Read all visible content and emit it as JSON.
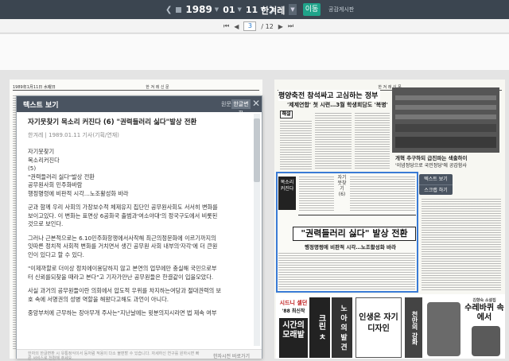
{
  "topbar": {
    "year": "1989",
    "month": "01",
    "day": "11",
    "paper_name": "한겨레",
    "move_button": "이동",
    "official_link": "공감게시판"
  },
  "pager": {
    "current": "3",
    "total": "/ 12"
  },
  "newspaper_left": {
    "header": "1989年1月11日 水曜日",
    "masthead": "한 겨 레 신 문"
  },
  "text_panel": {
    "title": "텍스트 보기",
    "original_button": "원문",
    "convert_button": "한글변환",
    "article_title": "자기뭇찾기 목소리 커진다 (6) \"권력들러리 싫다\"발상 전환",
    "meta": "한겨레 | 1989.01.11 기사(기획/연재)",
    "lines": [
      "자기뭇찾기",
      "목소리커진다",
      "  (5)",
      "\"권력들러리 싫다\"발상 전환",
      "공무원사회 민주화바람",
      "행정명령에 비판적 시각…노조활성화 바라",
      "",
      " 군과 함께 우리 사회의 가장보수적 체제유지 집단인 공무원사회도 서서히 변화를",
      "보이고있다. 이 변화는 표면상 6공화국 출범과'여소야대'의 정국구도에서 비롯된",
      "것으로 보인다.",
      "",
      " 그러나 근본적으로는 6.10민주화항쟁에서사작해 최근의정문화에 이르기까지의",
      "잇따른 정치적 사회적 변화를 거치면서 생긴 공무원 사회 내부의'자각'에 더 큰원",
      "인이 있다고 할 수 있다.",
      "",
      " \"이제까할로 더이상 정치에이용당하지 않고 본연의 업무에만 충실해 국민으로부",
      "터 신뢰를되찾을 때라고 본다\"고 기자가만난 공무원들은 한결같이 입을모았다.",
      "",
      " 사실 과거의 공무원들이란 의회에서 압도적 우위를 차지하는여당과 절대권력의 보",
      "호 속에 서명권의 성병 역할을 해왔다고해도 과언이 아니다.",
      "",
      " 중앙부처에 근무하는 장아무개 주사는\"지난날에는 윗분의지시라면 법 제속 여부"
    ],
    "footnote": "한자의 한글변환 시 유통정식이서 등처럼 적용이 다소 불편할 수 있습니다. 자세하신 연구를 원하시면 빠른 서비스로 전환해 주세요.",
    "footer_link": "한자시전 바로가기"
  },
  "newspaper_right": {
    "masthead": "한 겨 레 신 문",
    "headline": "평양축전 참석싸고 고심하는 정부",
    "subhead": "'제제연합' 첫 시련…3월 학생회담도 '복병'",
    "box_label": "해설",
    "photo_caption_1": "개혁 추구하되 급진파는 색출하이",
    "photo_caption_2": "'이념정당으로 국민정당'에 공감함사",
    "logo_text": "목소리 커진다",
    "vertical_title": "자기뭇찾기 (6)",
    "banner": "\"권력들러리 싫다\" 발상 전환",
    "banner_sub": "행정명령에 비판적 시각…노조활성화 바라",
    "popup_text": "텍스트 보기",
    "popup_scrap": "스크랩 하기",
    "ads": {
      "ad1_title": "시드니 셀던",
      "ad1_sub": "'88 최신작",
      "ad1_big": "시간의 모래밭",
      "ad2": "크린 ㅊ",
      "ad3": "노 아 의 발 견",
      "ad4": "인생은 자기 디자인",
      "ad5_top": "김향숙 소설집",
      "ad5": "수레바퀴 속에서",
      "ad6": "천만의 강화"
    }
  }
}
